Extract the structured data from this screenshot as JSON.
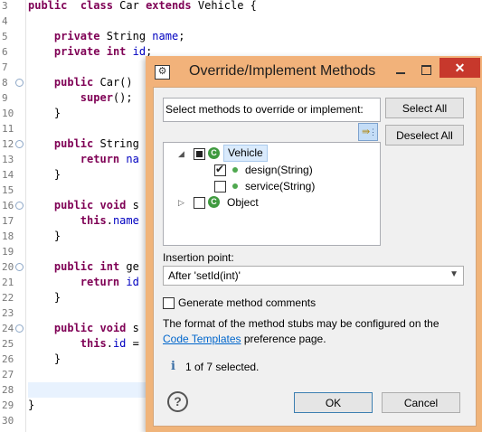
{
  "editor": {
    "lines": [
      {
        "num": "3",
        "fold": "",
        "tokens": [
          [
            "kw",
            "public"
          ],
          [
            "",
            "  "
          ],
          [
            "kw",
            "class"
          ],
          [
            "",
            " Car "
          ],
          [
            "kw",
            "extends"
          ],
          [
            "",
            " Vehicle {"
          ]
        ]
      },
      {
        "num": "4",
        "fold": "",
        "tokens": []
      },
      {
        "num": "5",
        "fold": "",
        "tokens": [
          [
            "",
            " "
          ],
          [
            "kw",
            "private"
          ],
          [
            "",
            " String "
          ],
          [
            "fld",
            "name"
          ],
          [
            "",
            ";"
          ]
        ]
      },
      {
        "num": "6",
        "fold": "",
        "tokens": [
          [
            "",
            " "
          ],
          [
            "kw",
            "private"
          ],
          [
            "",
            " "
          ],
          [
            "kw",
            "int"
          ],
          [
            "",
            " "
          ],
          [
            "fld",
            "id"
          ],
          [
            "",
            ";"
          ]
        ]
      },
      {
        "num": "7",
        "fold": "",
        "tokens": []
      },
      {
        "num": "8",
        "fold": "⊖",
        "tokens": [
          [
            "",
            " "
          ],
          [
            "kw",
            "public"
          ],
          [
            "",
            " Car()"
          ]
        ]
      },
      {
        "num": "9",
        "fold": "",
        "tokens": [
          [
            "",
            "     "
          ],
          [
            "kw",
            "super"
          ],
          [
            "",
            "();"
          ]
        ]
      },
      {
        "num": "10",
        "fold": "",
        "tokens": [
          [
            "",
            " }"
          ]
        ]
      },
      {
        "num": "11",
        "fold": "",
        "tokens": []
      },
      {
        "num": "12",
        "fold": "⊖",
        "tokens": [
          [
            "",
            " "
          ],
          [
            "kw",
            "public"
          ],
          [
            "",
            " String"
          ]
        ]
      },
      {
        "num": "13",
        "fold": "",
        "tokens": [
          [
            "",
            "     "
          ],
          [
            "kw",
            "return"
          ],
          [
            "",
            " "
          ],
          [
            "fld",
            "na"
          ]
        ]
      },
      {
        "num": "14",
        "fold": "",
        "tokens": [
          [
            "",
            " }"
          ]
        ]
      },
      {
        "num": "15",
        "fold": "",
        "tokens": []
      },
      {
        "num": "16",
        "fold": "⊖",
        "tokens": [
          [
            "",
            " "
          ],
          [
            "kw",
            "public"
          ],
          [
            "",
            " "
          ],
          [
            "kw",
            "void"
          ],
          [
            "",
            " s"
          ]
        ]
      },
      {
        "num": "17",
        "fold": "",
        "tokens": [
          [
            "",
            "     "
          ],
          [
            "kw",
            "this"
          ],
          [
            "",
            "."
          ],
          [
            "fld",
            "name"
          ]
        ]
      },
      {
        "num": "18",
        "fold": "",
        "tokens": [
          [
            "",
            " }"
          ]
        ]
      },
      {
        "num": "19",
        "fold": "",
        "tokens": []
      },
      {
        "num": "20",
        "fold": "⊖",
        "tokens": [
          [
            "",
            " "
          ],
          [
            "kw",
            "public"
          ],
          [
            "",
            " "
          ],
          [
            "kw",
            "int"
          ],
          [
            "",
            " ge"
          ]
        ]
      },
      {
        "num": "21",
        "fold": "",
        "tokens": [
          [
            "",
            "     "
          ],
          [
            "kw",
            "return"
          ],
          [
            "",
            " "
          ],
          [
            "fld",
            "id"
          ]
        ]
      },
      {
        "num": "22",
        "fold": "",
        "tokens": [
          [
            "",
            " }"
          ]
        ]
      },
      {
        "num": "23",
        "fold": "",
        "tokens": []
      },
      {
        "num": "24",
        "fold": "⊖",
        "tokens": [
          [
            "",
            " "
          ],
          [
            "kw",
            "public"
          ],
          [
            "",
            " "
          ],
          [
            "kw",
            "void"
          ],
          [
            "",
            " s"
          ]
        ]
      },
      {
        "num": "25",
        "fold": "",
        "tokens": [
          [
            "",
            "     "
          ],
          [
            "kw",
            "this"
          ],
          [
            "",
            "."
          ],
          [
            "fld",
            "id"
          ],
          [
            "",
            " ="
          ]
        ]
      },
      {
        "num": "26",
        "fold": "",
        "tokens": [
          [
            "",
            " }"
          ]
        ]
      },
      {
        "num": "27",
        "fold": "",
        "tokens": []
      },
      {
        "num": "28",
        "fold": "",
        "tokens": [],
        "current": true
      },
      {
        "num": "29",
        "fold": "",
        "tokens": [
          [
            "",
            "}"
          ]
        ]
      },
      {
        "num": "30",
        "fold": "",
        "tokens": []
      }
    ]
  },
  "dialog": {
    "title": "Override/Implement Methods",
    "close_glyph": "✕",
    "section_label": "Select methods to override or implement:",
    "select_all": "Select All",
    "deselect_all": "Deselect All",
    "tree": [
      {
        "label": "Vehicle",
        "level": 0,
        "expanded": true,
        "check": "partial",
        "kind": "class",
        "selected": true
      },
      {
        "label": "design(String)",
        "level": 1,
        "check": "checked",
        "kind": "method"
      },
      {
        "label": "service(String)",
        "level": 1,
        "check": "unchecked",
        "kind": "method"
      },
      {
        "label": "Object",
        "level": 0,
        "expanded": false,
        "check": "unchecked",
        "kind": "class"
      }
    ],
    "insertion_label": "Insertion point:",
    "insertion_value": "After 'setId(int)'",
    "generate_comments_label": "Generate method comments",
    "generate_comments_checked": false,
    "info_line1": "The format of the method stubs may be configured on the",
    "info_link": "Code Templates",
    "info_line2_suffix": " preference page.",
    "status_icon_glyph": "i",
    "status": "1 of 7 selected.",
    "help_glyph": "?",
    "ok": "OK",
    "cancel": "Cancel"
  },
  "colors": {
    "keyword": "#7f0055",
    "field": "#0000c0",
    "title_bar": "#f2b27a",
    "close_button": "#c7382c",
    "link": "#0066cc",
    "class_icon": "#3f9a3f"
  }
}
